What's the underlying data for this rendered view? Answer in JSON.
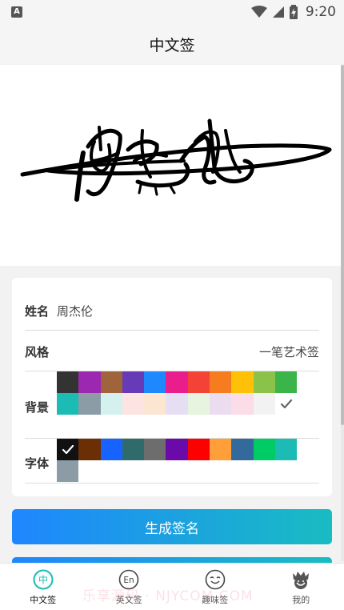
{
  "status_bar": {
    "time": "9:20",
    "app_badge": "A"
  },
  "header": {
    "title": "中文签"
  },
  "form": {
    "name_label": "姓名",
    "name_value": "周杰伦",
    "style_label": "风格",
    "style_value": "一笔艺术签",
    "background_label": "背景",
    "font_label": "字体"
  },
  "colors": {
    "background_swatches": [
      "#333333",
      "#9c27b0",
      "#a0643c",
      "#673ab7",
      "#1e88ff",
      "#e91e8c",
      "#f44336",
      "#f57c1f",
      "#ffc107",
      "#8bc34a",
      "#3bb44a",
      "#1bbcb4",
      "#8b9ca6",
      "#d4f1ef",
      "#fde3e1",
      "#fde6d1",
      "#e6def2",
      "#e7f5e0",
      "#ecdcf0",
      "#fbdde8",
      "#f2f2f2",
      "#ffffff"
    ],
    "background_selected_index": 21,
    "font_swatches": [
      "#111111",
      "#6b2e05",
      "#1763ff",
      "#2f6b6b",
      "#6d6d6d",
      "#6a0aa8",
      "#ff0000",
      "#ff9f3a",
      "#336a9d",
      "#00cc66",
      "#1cbcb4",
      "#8b9ca6"
    ],
    "font_selected_index": 0,
    "accent": "#1e86ff",
    "accent_end": "#19bcc2"
  },
  "actions": {
    "generate_label": "生成签名"
  },
  "tabs": [
    {
      "label": "中文签",
      "icon": "chinese-sign-icon",
      "glyph": "中",
      "active": true
    },
    {
      "label": "英文签",
      "icon": "english-sign-icon",
      "glyph": "En",
      "active": false
    },
    {
      "label": "趣味签",
      "icon": "fun-sign-icon",
      "glyph": "",
      "active": false
    },
    {
      "label": "我的",
      "icon": "profile-icon",
      "glyph": "",
      "active": false
    }
  ],
  "watermark": "乐享源码 · NJYCOM.COM"
}
